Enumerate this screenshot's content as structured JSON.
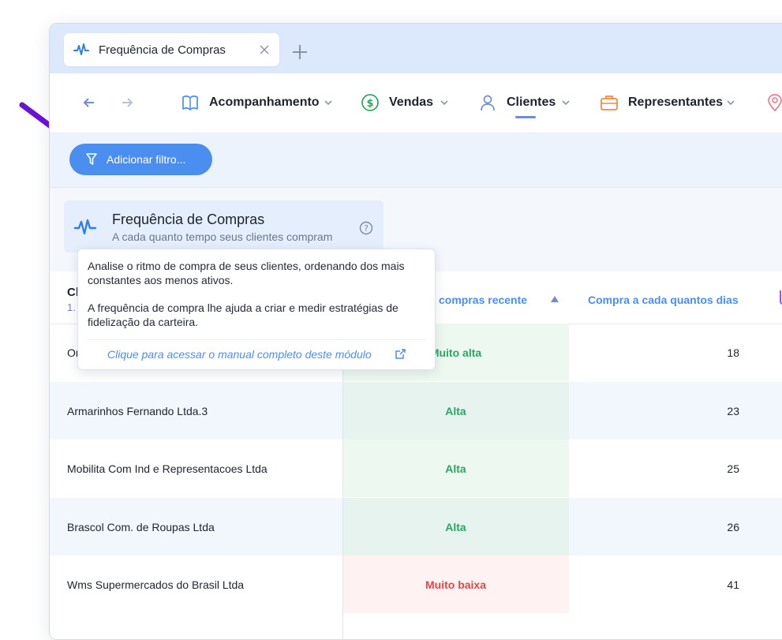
{
  "tab": {
    "title": "Frequência de Compras"
  },
  "nav": {
    "menu": [
      {
        "label": "Acompanhamento",
        "icon": "book-icon",
        "color": "#4a8ff0"
      },
      {
        "label": "Vendas",
        "icon": "dollar-circle-icon",
        "color": "#2aa760"
      },
      {
        "label": "Clientes",
        "icon": "user-icon",
        "color": "#6f8bd8"
      },
      {
        "label": "Representantes",
        "icon": "briefcase-icon",
        "color": "#f08a3c"
      },
      {
        "label": "",
        "icon": "map-pin-icon",
        "color": "#f07a8a"
      }
    ],
    "active": "Clientes"
  },
  "filter": {
    "button_label": "Adicionar filtro..."
  },
  "module": {
    "title": "Frequência de Compras",
    "subtitle": "A cada quanto tempo seus clientes compram"
  },
  "tooltip": {
    "p1": "Analise o ritmo de compra de seus clientes, ordenando dos mais constantes aos menos ativos.",
    "p2": "A frequência de compra lhe ajuda a criar e medir estratégias de fidelização da carteira.",
    "link": "Clique para acessar o manual completo deste módulo"
  },
  "table": {
    "col_client": "Cl",
    "col_client_sub": "1.",
    "col_freq": "compras recente",
    "col_days": "Compra a cada quantos dias",
    "rows": [
      {
        "name": "Or",
        "freq": "Muito alta",
        "days": "18",
        "status": "green"
      },
      {
        "name": "Armarinhos Fernando Ltda.3",
        "freq": "Alta",
        "days": "23",
        "status": "green"
      },
      {
        "name": "Mobilita Com Ind e Representacoes Ltda",
        "freq": "Alta",
        "days": "25",
        "status": "green"
      },
      {
        "name": "Brascol Com. de Roupas Ltda",
        "freq": "Alta",
        "days": "26",
        "status": "green"
      },
      {
        "name": "Wms Supermercados do Brasil Ltda",
        "freq": "Muito baixa",
        "days": "41",
        "status": "red"
      }
    ]
  },
  "colors": {
    "accent": "#4a8ff0",
    "annotation_arrow": "#6a12d6",
    "high": "#2aa760",
    "low": "#e04848"
  }
}
